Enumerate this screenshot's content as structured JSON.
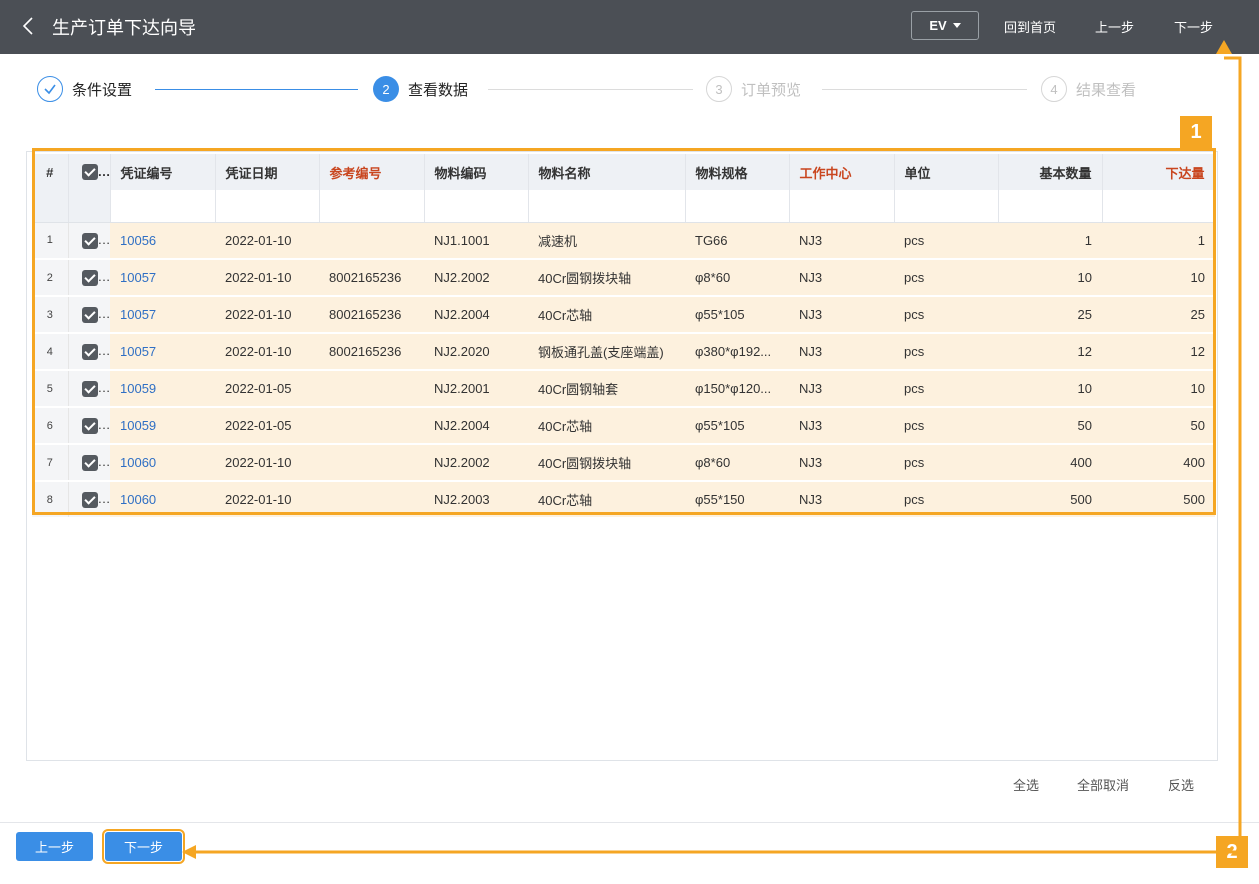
{
  "header": {
    "title": "生产订单下达向导",
    "ev_label": "EV",
    "home_label": "回到首页",
    "prev_label": "上一步",
    "next_label": "下一步"
  },
  "steps": [
    {
      "num": "1",
      "label": "条件设置",
      "state": "done"
    },
    {
      "num": "2",
      "label": "查看数据",
      "state": "active"
    },
    {
      "num": "3",
      "label": "订单预览",
      "state": "wait"
    },
    {
      "num": "4",
      "label": "结果查看",
      "state": "wait"
    }
  ],
  "table": {
    "columns": {
      "index": "#",
      "voucher_no": "凭证编号",
      "voucher_date": "凭证日期",
      "ref_no": "参考编号",
      "material_code": "物料编码",
      "material_name": "物料名称",
      "material_spec": "物料规格",
      "work_center": "工作中心",
      "unit": "单位",
      "base_qty": "基本数量",
      "release_qty": "下达量"
    },
    "rows": [
      {
        "idx": "1",
        "voucher_no": "10056",
        "voucher_date": "2022-01-10",
        "ref_no": "",
        "material_code": "NJ1.1001",
        "material_name": "减速机",
        "material_spec": "TG66",
        "work_center": "NJ3",
        "unit": "pcs",
        "base_qty": "1",
        "release_qty": "1"
      },
      {
        "idx": "2",
        "voucher_no": "10057",
        "voucher_date": "2022-01-10",
        "ref_no": "8002165236",
        "material_code": "NJ2.2002",
        "material_name": "40Cr圆钢拨块轴",
        "material_spec": "φ8*60",
        "work_center": "NJ3",
        "unit": "pcs",
        "base_qty": "10",
        "release_qty": "10"
      },
      {
        "idx": "3",
        "voucher_no": "10057",
        "voucher_date": "2022-01-10",
        "ref_no": "8002165236",
        "material_code": "NJ2.2004",
        "material_name": "40Cr芯轴",
        "material_spec": "φ55*105",
        "work_center": "NJ3",
        "unit": "pcs",
        "base_qty": "25",
        "release_qty": "25"
      },
      {
        "idx": "4",
        "voucher_no": "10057",
        "voucher_date": "2022-01-10",
        "ref_no": "8002165236",
        "material_code": "NJ2.2020",
        "material_name": "钢板通孔盖(支座端盖)",
        "material_spec": "φ380*φ192...",
        "work_center": "NJ3",
        "unit": "pcs",
        "base_qty": "12",
        "release_qty": "12"
      },
      {
        "idx": "5",
        "voucher_no": "10059",
        "voucher_date": "2022-01-05",
        "ref_no": "",
        "material_code": "NJ2.2001",
        "material_name": "40Cr圆钢轴套",
        "material_spec": "φ150*φ120...",
        "work_center": "NJ3",
        "unit": "pcs",
        "base_qty": "10",
        "release_qty": "10"
      },
      {
        "idx": "6",
        "voucher_no": "10059",
        "voucher_date": "2022-01-05",
        "ref_no": "",
        "material_code": "NJ2.2004",
        "material_name": "40Cr芯轴",
        "material_spec": "φ55*105",
        "work_center": "NJ3",
        "unit": "pcs",
        "base_qty": "50",
        "release_qty": "50"
      },
      {
        "idx": "7",
        "voucher_no": "10060",
        "voucher_date": "2022-01-10",
        "ref_no": "",
        "material_code": "NJ2.2002",
        "material_name": "40Cr圆钢拨块轴",
        "material_spec": "φ8*60",
        "work_center": "NJ3",
        "unit": "pcs",
        "base_qty": "400",
        "release_qty": "400"
      },
      {
        "idx": "8",
        "voucher_no": "10060",
        "voucher_date": "2022-01-10",
        "ref_no": "",
        "material_code": "NJ2.2003",
        "material_name": "40Cr芯轴",
        "material_spec": "φ55*150",
        "work_center": "NJ3",
        "unit": "pcs",
        "base_qty": "500",
        "release_qty": "500"
      }
    ]
  },
  "selection": {
    "select_all": "全选",
    "deselect_all": "全部取消",
    "invert": "反选"
  },
  "footer": {
    "prev_label": "上一步",
    "next_label": "下一步"
  },
  "annotations": {
    "badge_1": "1",
    "badge_2": "2",
    "color": "#f5a623"
  },
  "colors": {
    "header_bg": "#4b4f55",
    "accent": "#3a8ee6",
    "row_highlight": "#fdf1de",
    "required_header": "#c9461f",
    "link": "#2f6fc4"
  }
}
